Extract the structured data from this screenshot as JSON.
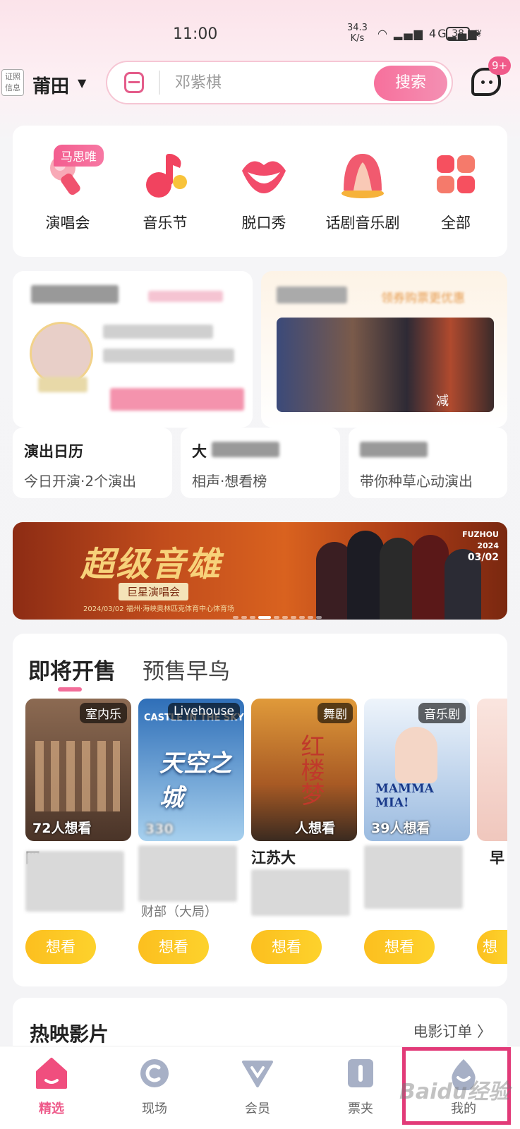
{
  "status_bar": {
    "time": "11:00",
    "net_speed": "34.3",
    "net_unit": "K/s",
    "signal": "4G",
    "battery": "38"
  },
  "header": {
    "cert_label": "证照信息",
    "city": "莆田",
    "search_placeholder": "邓紫棋",
    "search_button": "搜索",
    "message_badge": "9+"
  },
  "categories": [
    {
      "label": "演唱会",
      "icon": "microphone-icon",
      "tag": "马思唯"
    },
    {
      "label": "音乐节",
      "icon": "music-note-icon"
    },
    {
      "label": "脱口秀",
      "icon": "lips-icon"
    },
    {
      "label": "话剧音乐剧",
      "icon": "theater-icon"
    },
    {
      "label": "全部",
      "icon": "grid-icon"
    }
  ],
  "promos": {
    "right_snippet": "领券购票更优惠",
    "right_caption": "减"
  },
  "quick_entries": [
    {
      "title": "演出日历",
      "subtitle": "今日开演·2个演出"
    },
    {
      "title": "大",
      "subtitle": "相声·想看榜"
    },
    {
      "title": "",
      "subtitle": "带你种草心动演出"
    }
  ],
  "banner": {
    "title": "超级音雄",
    "subtitle": "巨星演唱会",
    "date_line": "2024/03/02  福州·海峡奥林匹克体育中心体育场",
    "city": "FUZHOU",
    "year": "2024",
    "date": "03/02"
  },
  "sales": {
    "tabs": [
      "即将开售",
      "预售早鸟"
    ],
    "items": [
      {
        "tag": "室内乐",
        "count": "72人想看",
        "title": "四",
        "button": "想看",
        "color_top": "#8c6a52",
        "color_bottom": "#4a3428"
      },
      {
        "tag": "Livehouse",
        "count": "330",
        "title": "",
        "meta": "财部（大局）",
        "button": "想看",
        "color_top": "#2f6fb8",
        "color_bottom": "#a7d0ee",
        "poster_title": "天空之城",
        "poster_en": "CASTLE IN THE SKY"
      },
      {
        "tag": "舞剧",
        "count": "人想看",
        "title": "江苏大",
        "button": "想看",
        "color_top": "#d58a2b",
        "color_bottom": "#3a2a20",
        "poster_title": "红楼梦"
      },
      {
        "tag": "音乐剧",
        "count": "39人想看",
        "title": "",
        "button": "想看",
        "color_top": "#e9f1fa",
        "color_bottom": "#9bbbe0",
        "poster_title": "MAMMA MIA!"
      },
      {
        "tag": "",
        "count": "",
        "title": "早",
        "button": "想",
        "color_top": "#fae5df",
        "color_bottom": "#f0c7bd"
      }
    ]
  },
  "hot_movies": {
    "title": "热映影片",
    "link": "电影订单"
  },
  "nav": [
    {
      "label": "精选",
      "icon": "home-icon",
      "active": true
    },
    {
      "label": "现场",
      "icon": "live-icon"
    },
    {
      "label": "会员",
      "icon": "vip-icon"
    },
    {
      "label": "票夹",
      "icon": "ticket-icon"
    },
    {
      "label": "我的",
      "icon": "profile-icon"
    }
  ],
  "watermark": "Baidu经验",
  "colors": {
    "accent": "#f26d99",
    "want_button": "#fcc21f",
    "highlight_box": "#e23a78"
  }
}
